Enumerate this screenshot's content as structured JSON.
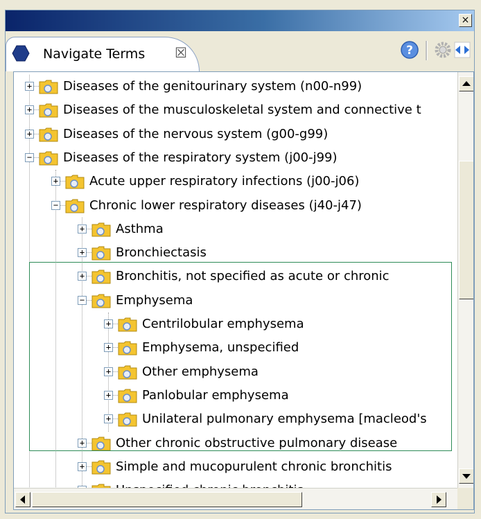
{
  "window": {
    "close_glyph": "×"
  },
  "tab": {
    "label": "Navigate Terms",
    "close_glyph": "☒",
    "icon": "hexagon-view-icon",
    "icon_color": "#1f3c8a"
  },
  "toolbar": {
    "help_icon": "help-icon",
    "settings_icon": "gear-icon",
    "link_icon": "link-editor-icon",
    "accent": "#2b6fd6"
  },
  "colors": {
    "folder": "#f4c430",
    "title_start": "#0a246a",
    "title_end": "#a6caf0",
    "highlight_border": "#2e8b57"
  },
  "tree": {
    "rows": [
      {
        "label": "Diseases of the genitourinary system (n00-n99)",
        "expander": "+",
        "depth": 0
      },
      {
        "label": "Diseases of the musculoskeletal system and connective t",
        "expander": "+",
        "depth": 0
      },
      {
        "label": "Diseases of the nervous system (g00-g99)",
        "expander": "+",
        "depth": 0
      },
      {
        "label": "Diseases of the respiratory system (j00-j99)",
        "expander": "−",
        "depth": 0
      },
      {
        "label": "Acute upper respiratory infections (j00-j06)",
        "expander": "+",
        "depth": 1
      },
      {
        "label": "Chronic lower respiratory diseases (j40-j47)",
        "expander": "−",
        "depth": 1
      },
      {
        "label": "Asthma",
        "expander": "+",
        "depth": 2
      },
      {
        "label": "Bronchiectasis",
        "expander": "+",
        "depth": 2
      },
      {
        "label": "Bronchitis, not specified as acute or chronic",
        "expander": "+",
        "depth": 2
      },
      {
        "label": "Emphysema",
        "expander": "−",
        "depth": 2
      },
      {
        "label": "Centrilobular emphysema",
        "expander": "+",
        "depth": 3
      },
      {
        "label": "Emphysema, unspecified",
        "expander": "+",
        "depth": 3
      },
      {
        "label": "Other emphysema",
        "expander": "+",
        "depth": 3
      },
      {
        "label": "Panlobular emphysema",
        "expander": "+",
        "depth": 3
      },
      {
        "label": "Unilateral pulmonary emphysema [macleod's",
        "expander": "+",
        "depth": 3
      },
      {
        "label": "Other chronic obstructive pulmonary disease",
        "expander": "+",
        "depth": 2
      },
      {
        "label": "Simple and mucopurulent chronic bronchitis",
        "expander": "+",
        "depth": 2
      },
      {
        "label": "Unspecified chronic bronchitis",
        "expander": "+",
        "depth": 2
      }
    ]
  },
  "scrollbars": {
    "up_glyph": "▲",
    "down_glyph": "▼",
    "left_glyph": "◀",
    "right_glyph": "▶"
  }
}
